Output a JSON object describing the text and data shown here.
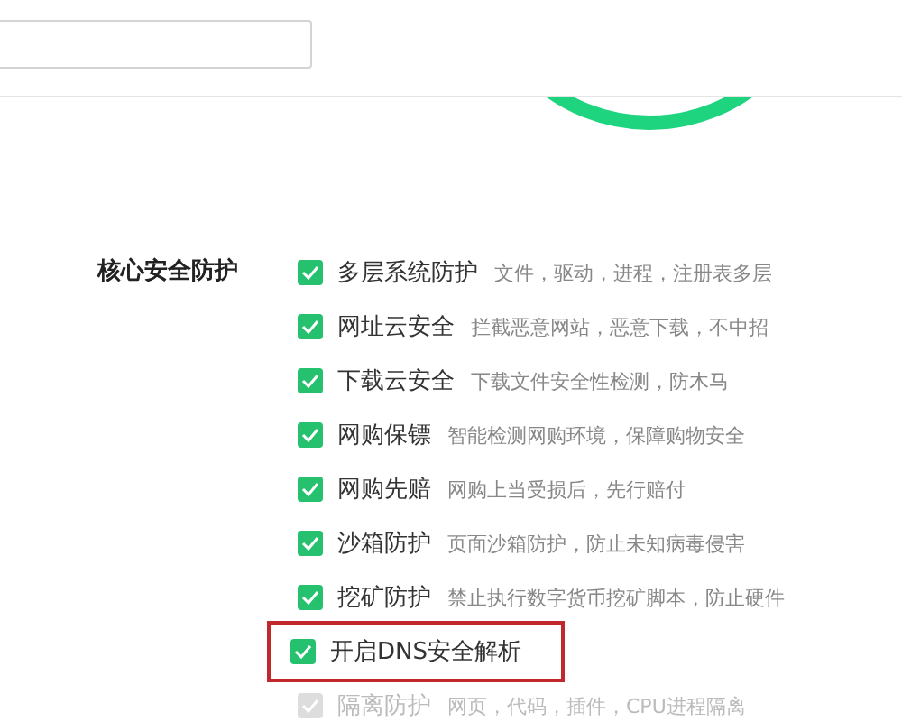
{
  "section": {
    "title": "核心安全防护",
    "options": [
      {
        "label": "多层系统防护",
        "description": "文件，驱动，进程，注册表多层",
        "checked": true,
        "disabled": false,
        "highlighted": false
      },
      {
        "label": "网址云安全",
        "description": "拦截恶意网站，恶意下载，不中招",
        "checked": true,
        "disabled": false,
        "highlighted": false
      },
      {
        "label": "下载云安全",
        "description": "下载文件安全性检测，防木马",
        "checked": true,
        "disabled": false,
        "highlighted": false
      },
      {
        "label": "网购保镖",
        "description": "智能检测网购环境，保障购物安全",
        "checked": true,
        "disabled": false,
        "highlighted": false
      },
      {
        "label": "网购先赔",
        "description": "网购上当受损后，先行赔付",
        "checked": true,
        "disabled": false,
        "highlighted": false
      },
      {
        "label": "沙箱防护",
        "description": "页面沙箱防护，防止未知病毒侵害",
        "checked": true,
        "disabled": false,
        "highlighted": false
      },
      {
        "label": "挖矿防护",
        "description": "禁止执行数字货币挖矿脚本，防止硬件",
        "checked": true,
        "disabled": false,
        "highlighted": false
      },
      {
        "label": "开启DNS安全解析",
        "checked": true,
        "disabled": false,
        "highlighted": true
      },
      {
        "label": "隔离防护",
        "description": "网页，代码，插件，CPU进程隔离",
        "checked": true,
        "disabled": true,
        "highlighted": false
      }
    ]
  }
}
